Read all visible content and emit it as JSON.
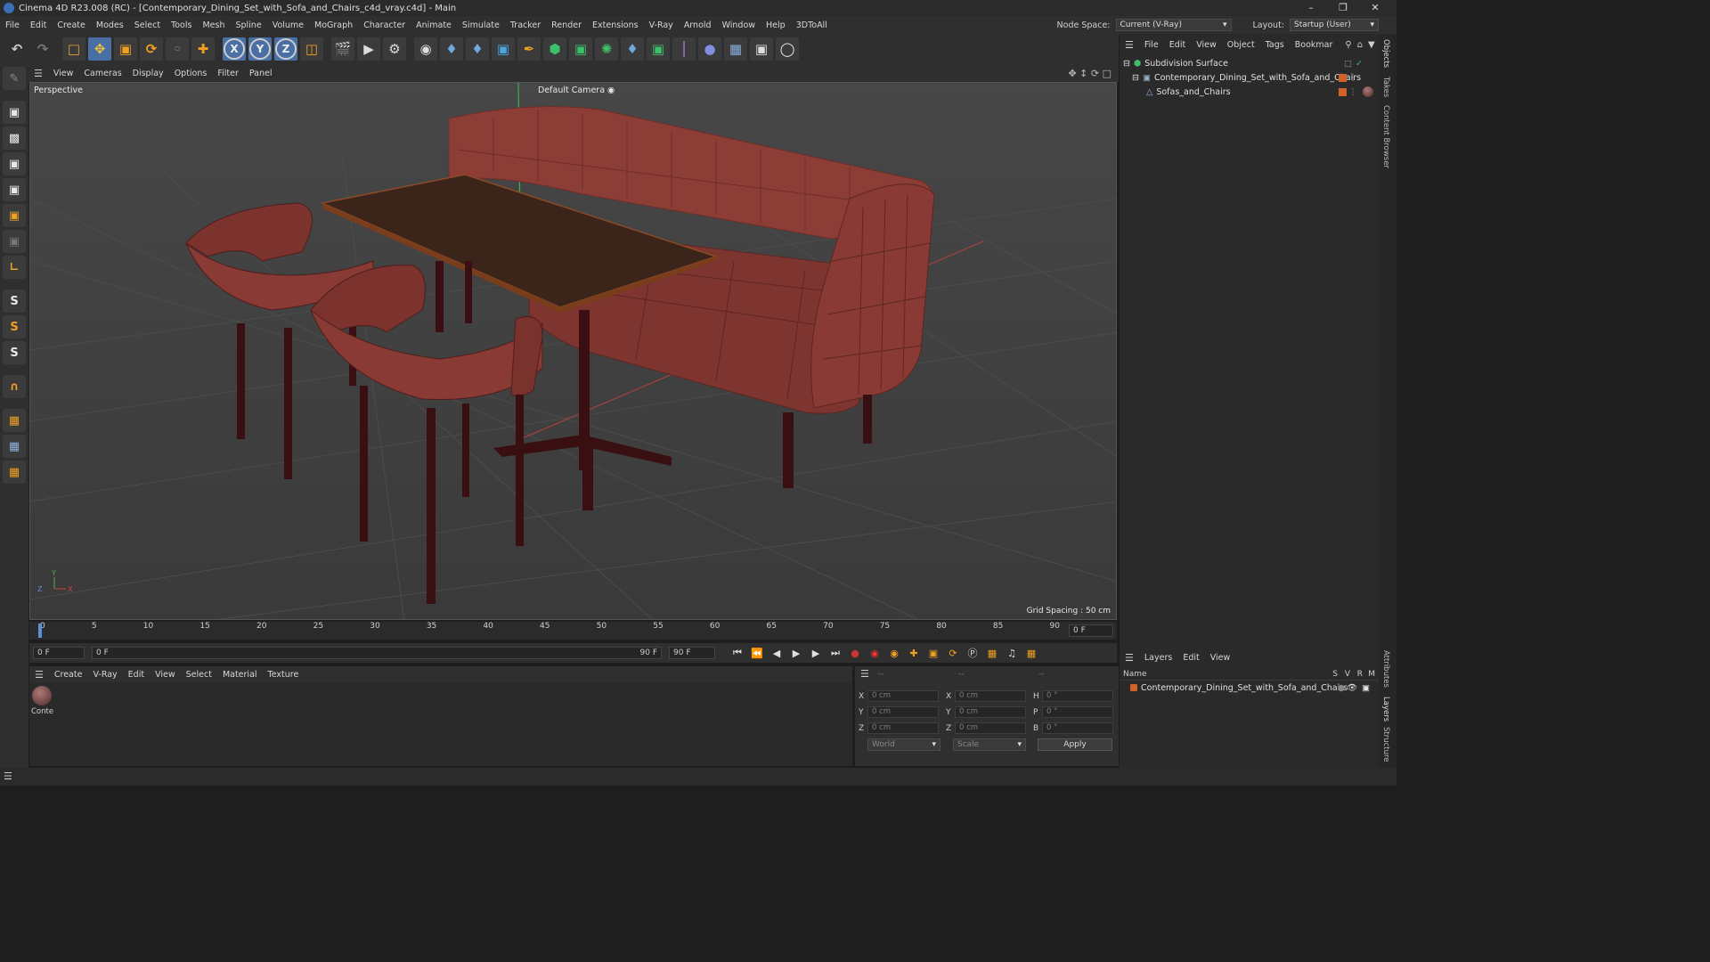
{
  "window": {
    "title": "Cinema 4D R23.008 (RC) - [Contemporary_Dining_Set_with_Sofa_and_Chairs_c4d_vray.c4d] - Main"
  },
  "menu": [
    "File",
    "Edit",
    "Create",
    "Modes",
    "Select",
    "Tools",
    "Mesh",
    "Spline",
    "Volume",
    "MoGraph",
    "Character",
    "Animate",
    "Simulate",
    "Tracker",
    "Render",
    "Extensions",
    "V-Ray",
    "Arnold",
    "Window",
    "Help",
    "3DToAll"
  ],
  "nodespace": {
    "label": "Node Space:",
    "value": "Current (V-Ray)"
  },
  "layout": {
    "label": "Layout:",
    "value": "Startup (User)"
  },
  "toolbar": {
    "axis_x": "X",
    "axis_y": "Y",
    "axis_z": "Z"
  },
  "lefttools": {
    "s1": "S",
    "s2": "S",
    "s3": "S"
  },
  "viewmenu": [
    "View",
    "Cameras",
    "Display",
    "Options",
    "Filter",
    "Panel"
  ],
  "viewport": {
    "label": "Perspective",
    "camera": "Default Camera",
    "grid": "Grid Spacing : 50 cm"
  },
  "timeline": {
    "ticks": [
      "0",
      "5",
      "10",
      "15",
      "20",
      "25",
      "30",
      "35",
      "40",
      "45",
      "50",
      "55",
      "60",
      "65",
      "70",
      "75",
      "80",
      "85",
      "90"
    ],
    "end_field": "0 F"
  },
  "transport": {
    "start": "0 F",
    "current": "0 F",
    "end_inner": "90 F",
    "end": "90 F"
  },
  "material_menu": [
    "Create",
    "V-Ray",
    "Edit",
    "View",
    "Select",
    "Material",
    "Texture"
  ],
  "material": {
    "name": "Conte"
  },
  "coords": {
    "header": "--",
    "x_label": "X",
    "y_label": "Y",
    "z_label": "Z",
    "h_label": "H",
    "p_label": "P",
    "b_label": "B",
    "pos_x": "0 cm",
    "pos_y": "0 cm",
    "pos_z": "0 cm",
    "size_x": "0 cm",
    "size_y": "0 cm",
    "size_z": "0 cm",
    "rot_h": "0 °",
    "rot_p": "0 °",
    "rot_b": "0 °",
    "mode1": "World",
    "mode2": "Scale",
    "apply": "Apply"
  },
  "objects_menu": [
    "File",
    "Edit",
    "View",
    "Object",
    "Tags",
    "Bookmar"
  ],
  "objects": [
    {
      "name": "Subdivision Surface"
    },
    {
      "name": "Contemporary_Dining_Set_with_Sofa_and_Chairs"
    },
    {
      "name": "Sofas_and_Chairs"
    }
  ],
  "layers_menu": [
    "Layers",
    "Edit",
    "View"
  ],
  "layers": {
    "col_name": "Name",
    "cols": [
      "S",
      "V",
      "R",
      "M"
    ],
    "row": "Contemporary_Dining_Set_with_Sofa_and_Chairs"
  },
  "sidetabs": [
    "Objects",
    "Takes",
    "Content Browser",
    "Attributes",
    "Layers",
    "Structure"
  ],
  "colors": {
    "accent": "#4a6fa5",
    "sofa": "#8a3a35",
    "table": "#3a2418",
    "layer_orange": "#d0622a"
  }
}
